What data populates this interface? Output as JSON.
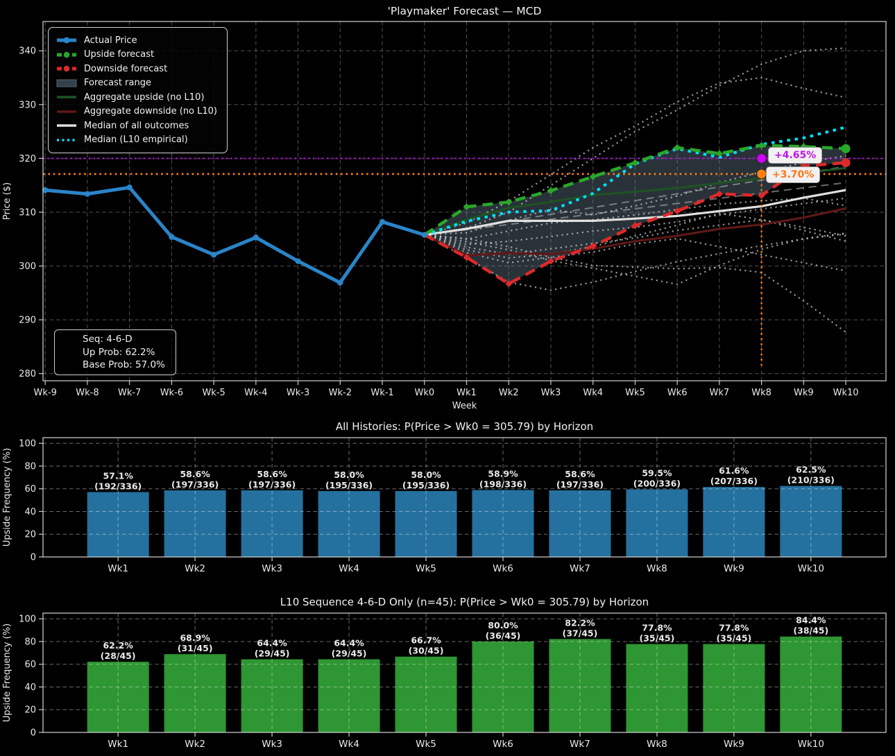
{
  "figure": {
    "background": "#000000"
  },
  "top_chart": {
    "info_box": {
      "lines": [
        "Seq: 4-6-D",
        "Up Prob: 62.2%",
        "Base Prob: 57.0%"
      ]
    },
    "annotations": [
      {
        "label": "+4.65%",
        "color": "#c214ea"
      },
      {
        "label": "+3.70%",
        "color": "#ff7514"
      }
    ],
    "legend": [
      {
        "key": "actual",
        "label": "Actual Price"
      },
      {
        "key": "upside",
        "label": "Upside forecast"
      },
      {
        "key": "downside",
        "label": "Downside forecast"
      },
      {
        "key": "range",
        "label": "Forecast range"
      },
      {
        "key": "agg_up",
        "label": "Aggregate upside (no L10)"
      },
      {
        "key": "agg_down",
        "label": "Aggregate downside (no L10)"
      },
      {
        "key": "median_all",
        "label": "Median of all outcomes"
      },
      {
        "key": "median_l10",
        "label": "Median (L10 empirical)"
      }
    ]
  },
  "chart_data": [
    {
      "type": "line",
      "title": "'Playmaker' Forecast — MCD",
      "xlabel": "Week",
      "ylabel": "Price ($)",
      "x_labels": [
        "Wk-9",
        "Wk-8",
        "Wk-7",
        "Wk-6",
        "Wk-5",
        "Wk-4",
        "Wk-3",
        "Wk-2",
        "Wk-1",
        "Wk0",
        "Wk1",
        "Wk2",
        "Wk3",
        "Wk4",
        "Wk5",
        "Wk6",
        "Wk7",
        "Wk8",
        "Wk9",
        "Wk10"
      ],
      "ylim": [
        278.5,
        345.5
      ],
      "yticks": [
        280,
        290,
        300,
        310,
        320,
        330,
        340
      ],
      "grid": true,
      "legend_position": "upper-left",
      "wk0_price": 305.79,
      "series": [
        {
          "name": "Actual Price",
          "color": "#2a84c8",
          "style": "solid-marker",
          "x": [
            -9,
            -8,
            -7,
            -6,
            -5,
            -4,
            -3,
            -2,
            -1,
            0
          ],
          "values": [
            314.1,
            313.4,
            314.6,
            305.4,
            302.1,
            305.3,
            300.9,
            296.9,
            308.2,
            305.79
          ]
        },
        {
          "name": "Upside forecast",
          "color": "#2aa82a",
          "style": "dashed-marker",
          "x": [
            0,
            1,
            2,
            3,
            4,
            5,
            6,
            7,
            8,
            9,
            10
          ],
          "values": [
            305.79,
            311.0,
            311.9,
            314.0,
            316.6,
            319.2,
            322.0,
            320.9,
            322.4,
            322.2,
            321.8
          ]
        },
        {
          "name": "Downside forecast",
          "color": "#dc2a2a",
          "style": "dashed-marker",
          "x": [
            0,
            1,
            2,
            3,
            4,
            5,
            6,
            7,
            8,
            9,
            10
          ],
          "values": [
            305.79,
            301.6,
            296.7,
            300.9,
            303.7,
            307.5,
            310.2,
            313.4,
            313.1,
            318.6,
            319.2
          ]
        },
        {
          "name": "Aggregate upside (no L10)",
          "color": "#1e5224",
          "style": "solid",
          "x": [
            0,
            1,
            2,
            3,
            4,
            5,
            6,
            7,
            8,
            9,
            10
          ],
          "values": [
            305.79,
            308.6,
            310.8,
            311.9,
            313.2,
            313.8,
            314.5,
            315.4,
            316.3,
            317.3,
            318.2
          ]
        },
        {
          "name": "Aggregate downside (no L10)",
          "color": "#5e1818",
          "style": "solid",
          "x": [
            0,
            1,
            2,
            3,
            4,
            5,
            6,
            7,
            8,
            9,
            10
          ],
          "values": [
            305.79,
            302.0,
            302.4,
            302.2,
            303.2,
            304.6,
            305.6,
            306.9,
            307.7,
            309.0,
            310.7
          ]
        },
        {
          "name": "Median of all outcomes",
          "color": "#e0e0e0",
          "style": "solid",
          "x": [
            0,
            1,
            2,
            3,
            4,
            5,
            6,
            7,
            8,
            9,
            10
          ],
          "values": [
            305.79,
            306.9,
            308.4,
            308.4,
            308.4,
            308.8,
            309.3,
            310.2,
            311.1,
            312.7,
            314.1
          ]
        },
        {
          "name": "Median (L10 empirical)",
          "color": "#00e1ff",
          "style": "dotted",
          "x": [
            0,
            1,
            2,
            3,
            4,
            5,
            6,
            7,
            8,
            9,
            10
          ],
          "values": [
            305.79,
            308.3,
            310.0,
            310.3,
            313.5,
            319.0,
            321.8,
            320.2,
            322.6,
            323.8,
            325.8
          ]
        }
      ],
      "band": {
        "name": "Forecast range",
        "color": "rgba(104,126,142,0.40)",
        "x": [
          0,
          1,
          2,
          3,
          4,
          5,
          6,
          7,
          8,
          9,
          10
        ],
        "upper": [
          305.79,
          311.0,
          311.9,
          314.0,
          316.6,
          319.2,
          322.0,
          320.9,
          322.4,
          322.2,
          321.8
        ],
        "lower": [
          305.79,
          301.6,
          296.7,
          300.9,
          303.7,
          307.5,
          310.2,
          313.4,
          313.1,
          318.6,
          319.2
        ]
      },
      "histories": {
        "color": "#d0d0d0",
        "x": [
          0,
          1,
          2,
          3,
          4,
          5,
          6,
          7,
          8,
          9,
          10
        ],
        "lines": [
          [
            305.79,
            307.0,
            310.0,
            315.0,
            320.0,
            325.0,
            329.0,
            333.5,
            337.5,
            340.0,
            340.5
          ],
          [
            305.79,
            308.0,
            312.0,
            317.0,
            322.0,
            326.0,
            330.5,
            334.0,
            335.0,
            333.0,
            331.3
          ],
          [
            305.79,
            306.2,
            308.5,
            310.5,
            309.5,
            311.2,
            313.0,
            315.5,
            317.5,
            319.2,
            320.5
          ],
          [
            305.79,
            305.0,
            306.5,
            308.0,
            308.6,
            309.5,
            310.5,
            311.5,
            312.1,
            312.6,
            311.2
          ],
          [
            305.79,
            304.0,
            304.6,
            305.5,
            306.5,
            307.2,
            308.2,
            309.5,
            310.6,
            311.6,
            312.6
          ],
          [
            305.79,
            303.5,
            302.2,
            303.2,
            304.2,
            305.2,
            306.6,
            307.6,
            308.6,
            307.2,
            305.6
          ],
          [
            305.79,
            303.0,
            301.5,
            302.2,
            303.6,
            305.6,
            307.6,
            309.8,
            308.6,
            306.6,
            304.6
          ],
          [
            305.79,
            302.5,
            300.6,
            301.6,
            302.6,
            304.1,
            305.1,
            303.6,
            302.1,
            300.6,
            299.1
          ],
          [
            305.79,
            304.5,
            303.0,
            301.0,
            299.6,
            298.1,
            296.6,
            300.1,
            303.1,
            305.1,
            306.1
          ],
          [
            305.79,
            305.1,
            303.6,
            301.6,
            300.1,
            299.8,
            299.5,
            299.7,
            298.8,
            293.5,
            287.7
          ],
          [
            305.79,
            301.5,
            297.0,
            295.5,
            297.0,
            299.0,
            300.8,
            302.3,
            303.8,
            305.0,
            306.0
          ]
        ]
      },
      "trend_lines": {
        "color": "#b0b0b0",
        "x": [
          0,
          10
        ],
        "lines": [
          [
            305.79,
            318.5
          ],
          [
            305.79,
            315.5
          ]
        ]
      },
      "hlines": [
        {
          "value": 320.0,
          "color": "#cf00ff"
        },
        {
          "value": 317.1,
          "color": "#ff7f16"
        }
      ],
      "vline": {
        "week": 8,
        "from": 317.1,
        "to": 281.0,
        "color": "#ff7f16"
      },
      "points": [
        {
          "week": 8,
          "value": 320.0,
          "color": "#cf00ff",
          "label": "+4.65%"
        },
        {
          "week": 8,
          "value": 317.1,
          "color": "#ff7f16",
          "label": "+3.70%"
        }
      ]
    },
    {
      "type": "bar",
      "title": "All Histories: P(Price > Wk0 = 305.79) by Horizon",
      "ylabel": "Upside Frequency (%)",
      "categories": [
        "Wk1",
        "Wk2",
        "Wk3",
        "Wk4",
        "Wk5",
        "Wk6",
        "Wk7",
        "Wk8",
        "Wk9",
        "Wk10"
      ],
      "values": [
        57.1,
        58.6,
        58.6,
        58.0,
        58.0,
        58.9,
        58.6,
        59.5,
        61.6,
        62.5
      ],
      "pct_labels": [
        "57.1%",
        "58.6%",
        "58.6%",
        "58.0%",
        "58.0%",
        "58.9%",
        "58.6%",
        "59.5%",
        "61.6%",
        "62.5%"
      ],
      "count_labels": [
        "(192/336)",
        "(197/336)",
        "(197/336)",
        "(195/336)",
        "(195/336)",
        "(198/336)",
        "(197/336)",
        "(200/336)",
        "(207/336)",
        "(210/336)"
      ],
      "bar_color": "#24719f",
      "ylim": [
        0,
        105
      ],
      "yticks": [
        0,
        20,
        40,
        60,
        80,
        100
      ],
      "grid": true
    },
    {
      "type": "bar",
      "title": "L10 Sequence 4-6-D Only (n=45): P(Price > Wk0 = 305.79) by Horizon",
      "ylabel": "Upside Frequency (%)",
      "categories": [
        "Wk1",
        "Wk2",
        "Wk3",
        "Wk4",
        "Wk5",
        "Wk6",
        "Wk7",
        "Wk8",
        "Wk9",
        "Wk10"
      ],
      "values": [
        62.2,
        68.9,
        64.4,
        64.4,
        66.7,
        80.0,
        82.2,
        77.8,
        77.8,
        84.4
      ],
      "pct_labels": [
        "62.2%",
        "68.9%",
        "64.4%",
        "64.4%",
        "66.7%",
        "80.0%",
        "82.2%",
        "77.8%",
        "77.8%",
        "84.4%"
      ],
      "count_labels": [
        "(28/45)",
        "(31/45)",
        "(29/45)",
        "(29/45)",
        "(30/45)",
        "(36/45)",
        "(37/45)",
        "(35/45)",
        "(35/45)",
        "(38/45)"
      ],
      "bar_color": "#2e9632",
      "ylim": [
        0,
        105
      ],
      "yticks": [
        0,
        20,
        40,
        60,
        80,
        100
      ],
      "grid": true
    }
  ]
}
